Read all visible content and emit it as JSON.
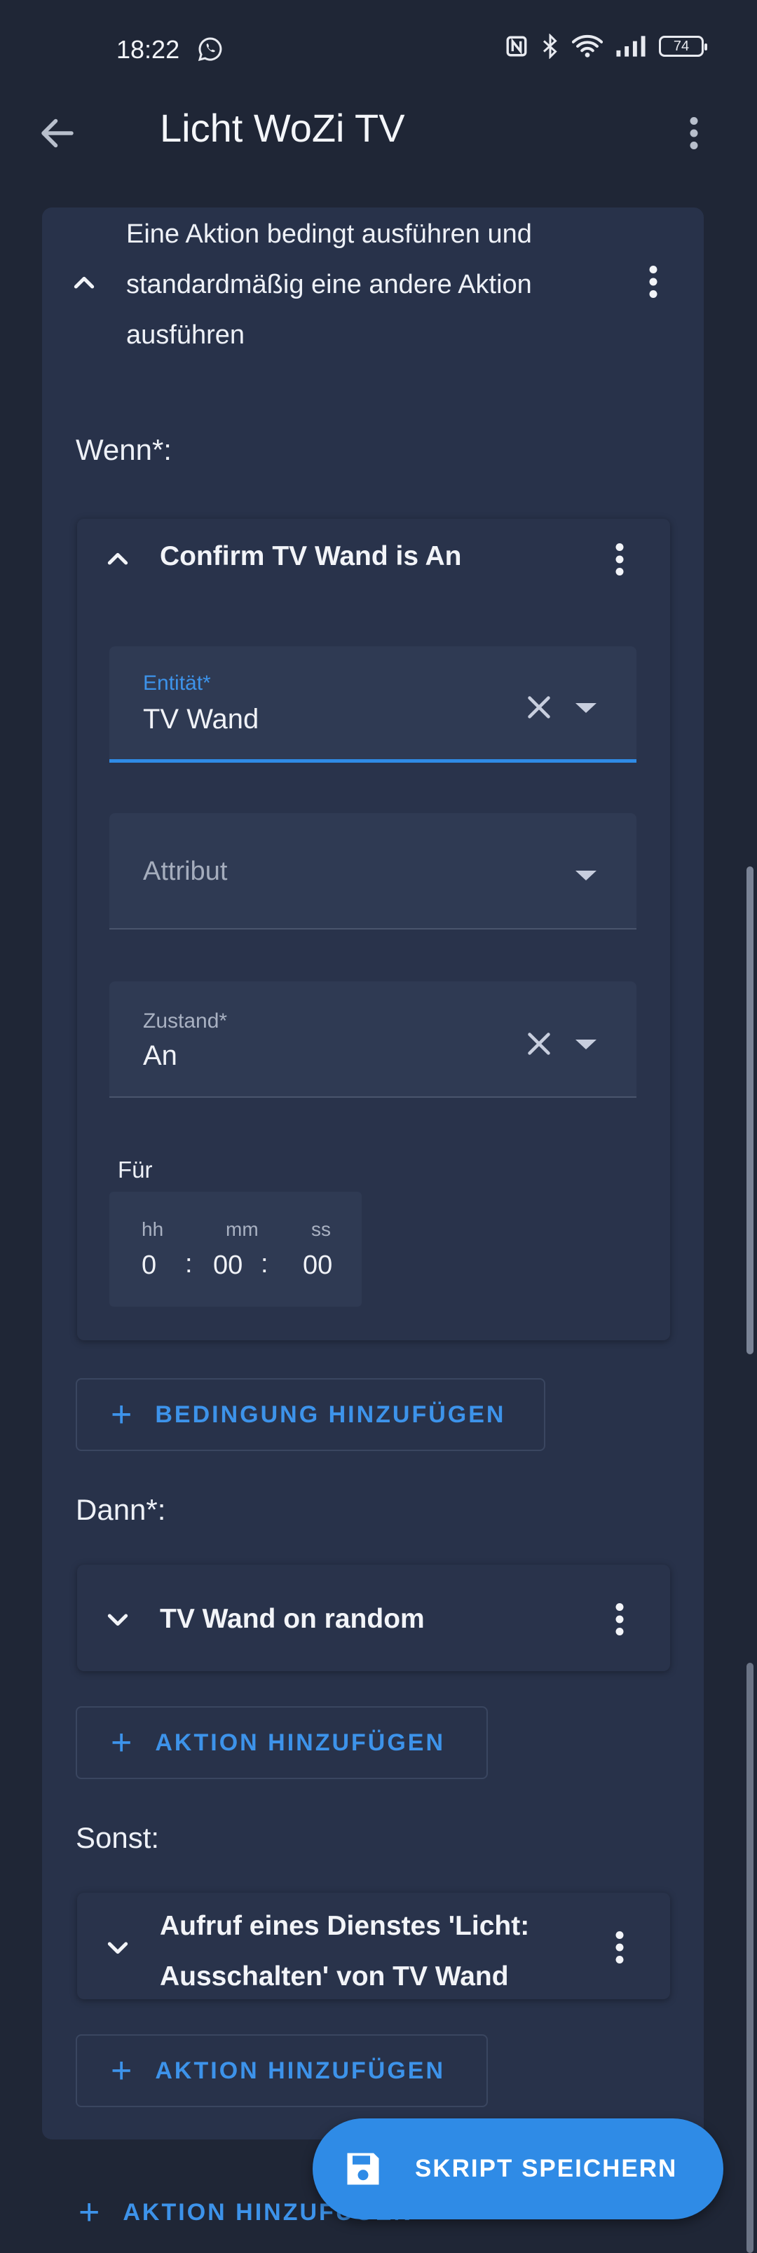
{
  "status": {
    "time": "18:22",
    "battery": "74"
  },
  "header": {
    "title": "Licht WoZi TV"
  },
  "card": {
    "title_lines": [
      "Eine Aktion bedingt ausführen und",
      "standardmäßig eine andere Aktion",
      "ausführen"
    ],
    "if_label": "Wenn*:",
    "condition": {
      "title": "Confirm TV Wand is An",
      "entity": {
        "label": "Entität*",
        "value": "TV Wand"
      },
      "attribute": {
        "placeholder": "Attribut"
      },
      "state": {
        "label": "Zustand*",
        "value": "An"
      },
      "for_label": "Für",
      "duration": {
        "hh_label": "hh",
        "mm_label": "mm",
        "ss_label": "ss",
        "hh": "0",
        "mm": "00",
        "ss": "00"
      }
    },
    "add_condition": "BEDINGUNG HINZUFÜGEN",
    "then_label": "Dann*:",
    "then_action": "TV Wand on random",
    "add_action_then": "AKTION HINZUFÜGEN",
    "else_label": "Sonst:",
    "else_action_lines": [
      "Aufruf eines Dienstes 'Licht:",
      "Ausschalten' von TV Wand"
    ],
    "add_action_else": "AKTION HINZUFÜGEN"
  },
  "bottom": {
    "add_action": "AKTION HINZUFÜGEN"
  },
  "fab": {
    "label": "SKRIPT SPEICHERN"
  },
  "colors": {
    "accent": "#2f8be6",
    "background": "#1f2636",
    "card": "#28324a"
  }
}
